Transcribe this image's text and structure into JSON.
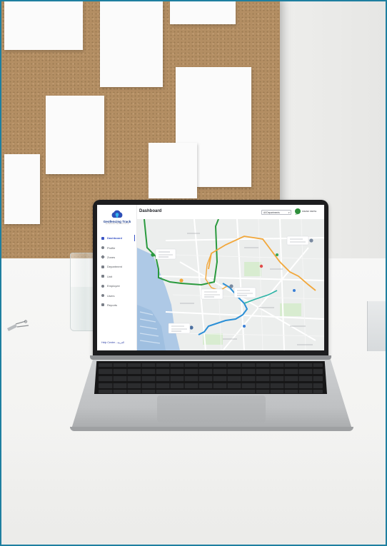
{
  "app": {
    "brand_name": "Geofencing Track",
    "brand_tagline": "GEOFENCING TRACKING SYSTEM"
  },
  "sidebar": {
    "items": [
      {
        "label": "Dashboard",
        "icon": "dashboard-icon",
        "active": true
      },
      {
        "label": "Profile",
        "icon": "profile-icon",
        "active": false
      },
      {
        "label": "Zones",
        "icon": "zones-icon",
        "active": false
      },
      {
        "label": "Department",
        "icon": "department-icon",
        "active": false
      },
      {
        "label": "Unit",
        "icon": "unit-icon",
        "active": false
      },
      {
        "label": "Employee",
        "icon": "employee-icon",
        "active": false
      },
      {
        "label": "Users",
        "icon": "users-icon",
        "active": false
      },
      {
        "label": "Reports",
        "icon": "reports-icon",
        "active": false
      }
    ],
    "help_label": "Help Center - العربية"
  },
  "header": {
    "title": "Dashboard",
    "department_select": {
      "value": "All Departments"
    },
    "user": {
      "name": "FRANK SMITH",
      "avatar_text": "GEO"
    }
  },
  "map": {
    "route_colors": {
      "green": "#2a9a3e",
      "blue": "#2b8fd6",
      "orange": "#f2a73a",
      "teal": "#2bb3a6"
    },
    "water_color": "#aec9e6",
    "road_color": "#ffffff"
  },
  "colors": {
    "accent": "#3b55c6",
    "frame": "#1e7fa0"
  }
}
